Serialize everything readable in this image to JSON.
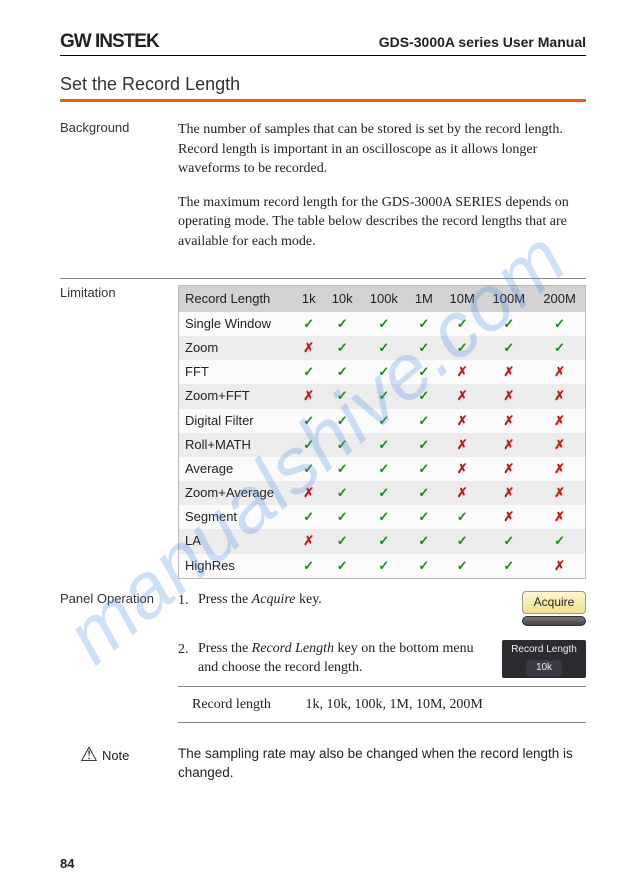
{
  "header": {
    "logo": "GW INSTEK",
    "doc_title": "GDS-3000A series User Manual"
  },
  "section_title": "Set the Record Length",
  "background": {
    "label": "Background",
    "p1": "The number of samples that can be stored is set by the record length. Record length is important in an oscilloscope as it allows longer waveforms to be recorded.",
    "p2": "The maximum record length for the GDS-3000A SERIES depends on operating mode. The table below describes the record lengths that are available for each mode."
  },
  "limitation": {
    "label": "Limitation",
    "header_label": "Record Length",
    "columns": [
      "1k",
      "10k",
      "100k",
      "1M",
      "10M",
      "100M",
      "200M"
    ],
    "rows": [
      {
        "name": "Single Window",
        "v": [
          true,
          true,
          true,
          true,
          true,
          true,
          true
        ]
      },
      {
        "name": "Zoom",
        "v": [
          false,
          true,
          true,
          true,
          true,
          true,
          true
        ]
      },
      {
        "name": "FFT",
        "v": [
          true,
          true,
          true,
          true,
          false,
          false,
          false
        ]
      },
      {
        "name": "Zoom+FFT",
        "v": [
          false,
          true,
          true,
          true,
          false,
          false,
          false
        ]
      },
      {
        "name": "Digital Filter",
        "v": [
          true,
          true,
          true,
          true,
          false,
          false,
          false
        ]
      },
      {
        "name": "Roll+MATH",
        "v": [
          true,
          true,
          true,
          true,
          false,
          false,
          false
        ]
      },
      {
        "name": "Average",
        "v": [
          true,
          true,
          true,
          true,
          false,
          false,
          false
        ]
      },
      {
        "name": "Zoom+Average",
        "v": [
          false,
          true,
          true,
          true,
          false,
          false,
          false
        ]
      },
      {
        "name": "Segment",
        "v": [
          true,
          true,
          true,
          true,
          true,
          false,
          false
        ]
      },
      {
        "name": "LA",
        "v": [
          false,
          true,
          true,
          true,
          true,
          true,
          true
        ]
      },
      {
        "name": "HighRes",
        "v": [
          true,
          true,
          true,
          true,
          true,
          true,
          false
        ]
      }
    ]
  },
  "panel_op": {
    "label": "Panel Operation",
    "step1_num": "1.",
    "step1_text_a": "Press the ",
    "step1_text_b": "Acquire",
    "step1_text_c": " key.",
    "acquire_label": "Acquire",
    "step2_num": "2.",
    "step2_text_a": "Press the ",
    "step2_text_b": "Record Length",
    "step2_text_c": " key on the bottom menu and choose the record length.",
    "chip_title": "Record Length",
    "chip_value": "10k",
    "reclen_key": "Record length",
    "reclen_values": "1k, 10k, 100k, 1M, 10M, 200M"
  },
  "note": {
    "label": "Note",
    "text": "The sampling rate may also be changed when the record length is changed."
  },
  "page_num": "84",
  "watermark": "manualshive.com"
}
